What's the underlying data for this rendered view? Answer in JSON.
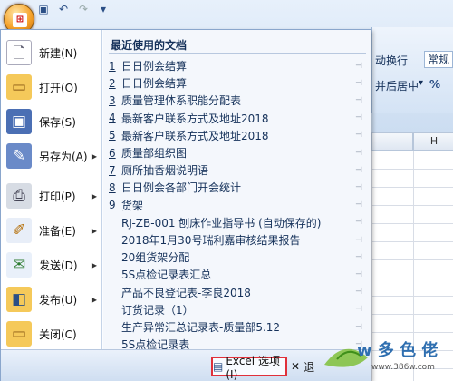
{
  "quick_access": {
    "save_icon": "save-icon",
    "undo_icon": "undo-icon",
    "redo_icon": "redo-icon",
    "customize_label": "▾"
  },
  "ribbon_fragments": {
    "wrap_text": "动换行",
    "format_value": "常规",
    "merge_center": "并后居中",
    "merge_arrow": "▾",
    "percent": "%",
    "column_h": "H"
  },
  "office_menu": {
    "commands": [
      {
        "label": "新建(N)",
        "icon": "new-document-icon",
        "has_arrow": false
      },
      {
        "label": "打开(O)",
        "icon": "open-folder-icon",
        "has_arrow": false
      },
      {
        "label": "保存(S)",
        "icon": "save-icon",
        "has_arrow": false
      },
      {
        "label": "另存为(A)",
        "icon": "save-as-icon",
        "has_arrow": true
      },
      {
        "label": "打印(P)",
        "icon": "print-icon",
        "has_arrow": true
      },
      {
        "label": "准备(E)",
        "icon": "prepare-icon",
        "has_arrow": true
      },
      {
        "label": "发送(D)",
        "icon": "send-icon",
        "has_arrow": true
      },
      {
        "label": "发布(U)",
        "icon": "publish-icon",
        "has_arrow": true
      },
      {
        "label": "关闭(C)",
        "icon": "close-folder-icon",
        "has_arrow": false
      }
    ],
    "recent_title": "最近使用的文档",
    "recent_docs": [
      {
        "num": "1",
        "name": "日日例会结算"
      },
      {
        "num": "2",
        "name": "日日例会结算"
      },
      {
        "num": "3",
        "name": "质量管理体系职能分配表"
      },
      {
        "num": "4",
        "name": "最新客户联系方式及地址2018"
      },
      {
        "num": "5",
        "name": "最新客户联系方式及地址2018"
      },
      {
        "num": "6",
        "name": "质量部组织图"
      },
      {
        "num": "7",
        "name": "厕所抽香烟说明语"
      },
      {
        "num": "8",
        "name": "日日例会各部门开会统计"
      },
      {
        "num": "9",
        "name": "货架"
      },
      {
        "num": "",
        "name": "RJ-ZB-001 刨床作业指导书 (自动保存的)"
      },
      {
        "num": "",
        "name": "2018年1月30号瑞利嘉审核结果报告"
      },
      {
        "num": "",
        "name": "20组货架分配"
      },
      {
        "num": "",
        "name": "5S点检记录表汇总"
      },
      {
        "num": "",
        "name": "产品不良登记表-李良2018"
      },
      {
        "num": "",
        "name": "订货记录（1）"
      },
      {
        "num": "",
        "name": "生产异常汇总记录表-质量部5.12"
      },
      {
        "num": "",
        "name": "5S点检记录表"
      }
    ],
    "options_button": "Excel 选项(I)",
    "exit_button": "退"
  },
  "watermark": {
    "text": "w 多 色 佬",
    "url": "www.386w.com"
  }
}
